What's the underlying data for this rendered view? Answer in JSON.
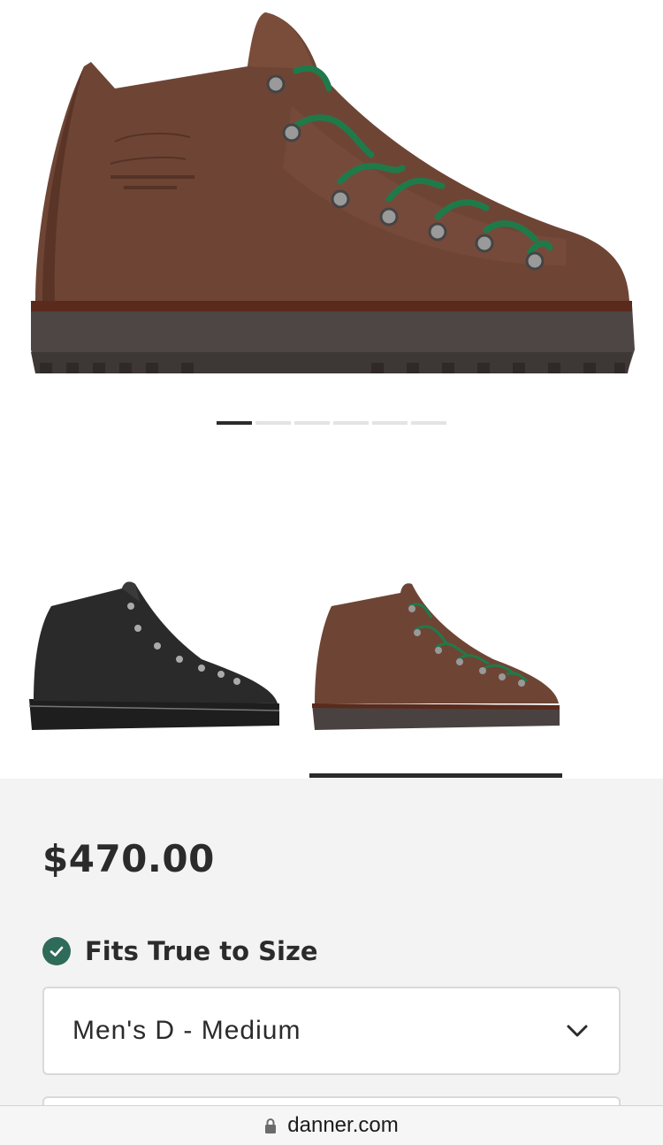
{
  "gallery": {
    "slide_count": 6,
    "active_slide": 1
  },
  "colors": [
    {
      "name": "black-boot",
      "selected": false
    },
    {
      "name": "brown-boot",
      "selected": true
    }
  ],
  "product": {
    "price": "$470.00",
    "fit_label": "Fits True to Size",
    "width_select": "Men's D - Medium"
  },
  "browser": {
    "url": "danner.com"
  },
  "theme": {
    "panel_bg": "#f3f3f3",
    "check_green": "#2e6b58",
    "boot_brown": "#6e4535",
    "lace_green": "#1f7a4a"
  },
  "icons": [
    "check-circle-icon",
    "chevron-down-icon",
    "lock-icon"
  ]
}
